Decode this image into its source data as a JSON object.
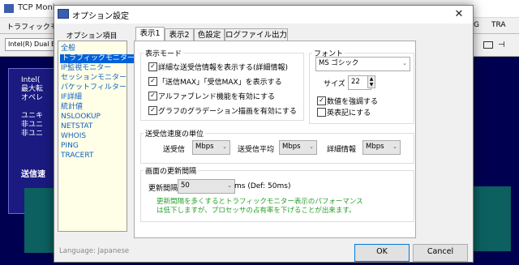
{
  "background": {
    "title": "TCP Moni",
    "tabs": [
      {
        "label": "トラフィックモ"
      },
      {
        "label": "G"
      },
      {
        "label": "TRA"
      }
    ],
    "adapter": "Intel(R) Dual B",
    "panel_lines": [
      "Intel(",
      "最大転",
      "オペレ",
      "",
      "ユニキ",
      "非ユニ",
      "非ユニ"
    ],
    "send_label": "送信速"
  },
  "dialog": {
    "title": "オプション設定",
    "left_header": "オプション項目",
    "items": [
      {
        "label": "全般"
      },
      {
        "label": "トラフィックモニター"
      },
      {
        "label": "IP監視モニター"
      },
      {
        "label": "セッションモニター"
      },
      {
        "label": "パケットフィルター"
      },
      {
        "label": "IF詳細"
      },
      {
        "label": "統計値"
      },
      {
        "label": "NSLOOKUP"
      },
      {
        "label": "NETSTAT"
      },
      {
        "label": "WHOIS"
      },
      {
        "label": "PING"
      },
      {
        "label": "TRACERT"
      }
    ],
    "language": "Language: Japanese",
    "tabs": [
      {
        "label": "表示1"
      },
      {
        "label": "表示2"
      },
      {
        "label": "色設定"
      },
      {
        "label": "ログファイル出力"
      }
    ],
    "display_mode": {
      "title": "表示モード",
      "checks": [
        {
          "label": "詳細な送受信情報を表示する(詳細情報)",
          "checked": "✓"
        },
        {
          "label": "「送信MAX」「受信MAX」を表示する",
          "checked": "✓"
        },
        {
          "label": "アルファブレンド機能を有効にする",
          "checked": "✓"
        },
        {
          "label": "グラフのグラデーション描画を有効にする",
          "checked": "✓"
        }
      ]
    },
    "font": {
      "title": "フォント",
      "family": "MS ゴシック",
      "size_label": "サイズ",
      "size": "22",
      "bold_label": "数値を強調する",
      "bold_checked": "✓",
      "english_label": "英表記にする",
      "english_checked": ""
    },
    "speed_unit": {
      "title": "送受信速度の単位",
      "send_label": "送受信",
      "send_value": "Mbps",
      "avg_label": "送受信平均",
      "avg_value": "Mbps",
      "detail_label": "詳細情報",
      "detail_value": "Mbps"
    },
    "refresh": {
      "title": "画面の更新間隔",
      "label": "更新間隔",
      "value": "50",
      "unit": "ms (Def: 50ms)",
      "note_line1": "更新間隔を多くするとトラフィックモニター表示のパフォーマンス",
      "note_line2": "は低下しますが、プロセッサの占有率を下げることが出来ます。"
    },
    "ok_label": "OK",
    "cancel_label": "Cancel"
  }
}
